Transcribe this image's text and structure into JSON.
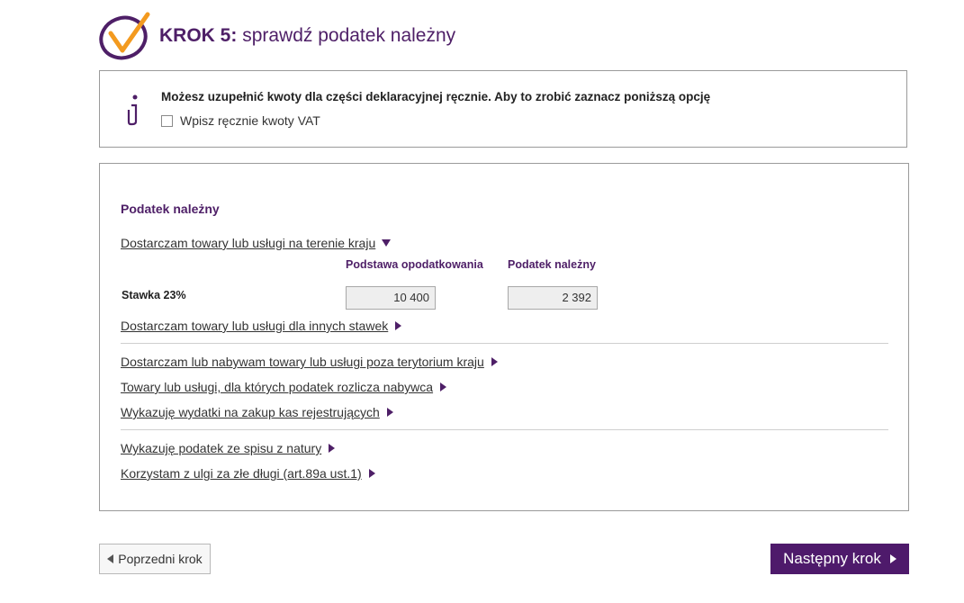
{
  "header": {
    "step_label": "KROK 5:",
    "step_text": "sprawdź podatek należny"
  },
  "info": {
    "text": "Możesz uzupełnić kwoty dla części deklaracyjnej ręcznie. Aby to zrobić zaznacz poniższą opcję",
    "checkbox_label": "Wpisz ręcznie kwoty VAT",
    "checkbox_checked": false
  },
  "main": {
    "section_title": "Podatek należny",
    "domestic_link": "Dostarczam towary lub usługi na terenie kraju",
    "col_base": "Podstawa opodatkowania",
    "col_tax": "Podatek należny",
    "rate_label": "Stawka 23%",
    "base_value": "10 400",
    "tax_value": "2 392",
    "other_rates_link": "Dostarczam towary lub usługi dla innych stawek",
    "abroad_link": "Dostarczam lub nabywam towary lub usługi poza terytorium kraju",
    "reverse_charge_link": "Towary lub usługi, dla których podatek rozlicza nabywca",
    "cash_register_link": "Wykazuję wydatki na zakup kas rejestrujących",
    "inventory_link": "Wykazuję podatek ze spisu z natury",
    "bad_debt_link": "Korzystam z ulgi za złe długi (art.89a ust.1)"
  },
  "nav": {
    "prev_label": "Poprzedni krok",
    "next_label": "Następny krok"
  },
  "colors": {
    "brand_purple": "#4e1f67",
    "logo_orange": "#f39a1f"
  }
}
